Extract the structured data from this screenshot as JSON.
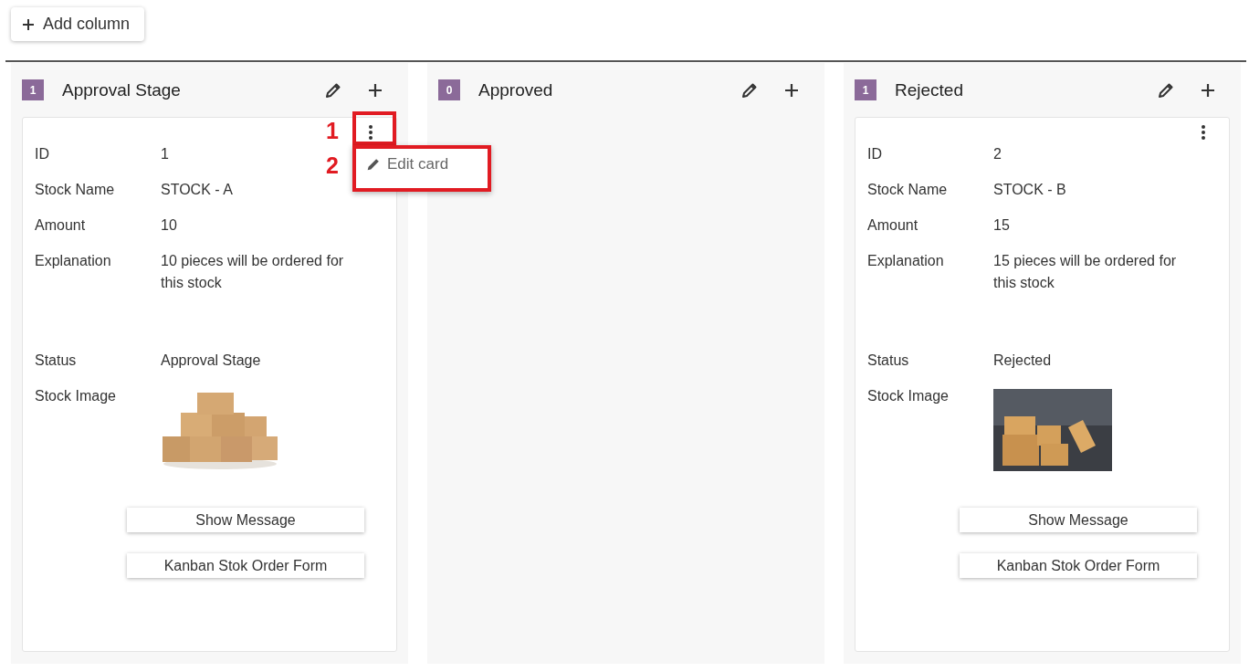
{
  "toolbar": {
    "add_button": "Add column"
  },
  "columns": [
    {
      "count": "1",
      "title": "Approval Stage",
      "cards": [
        {
          "fields": [
            {
              "kind": "text",
              "label": "ID",
              "value": "1"
            },
            {
              "kind": "text",
              "label": "Stock Name",
              "value": "STOCK - A"
            },
            {
              "kind": "text",
              "label": "Amount",
              "value": "10"
            },
            {
              "kind": "long",
              "label": "Explanation",
              "value": "10 pieces will be ordered for this stock"
            },
            {
              "kind": "text",
              "label": "Status",
              "value": "Approval Stage"
            },
            {
              "label": "Stock Image"
            }
          ],
          "buttons": [
            "Show Message",
            "Kanban Stok Order Form"
          ],
          "menu_callout": "1",
          "menu": {
            "callout": "2",
            "items": [
              "Edit card"
            ]
          }
        }
      ]
    },
    {
      "count": "0",
      "title": "Approved"
    },
    {
      "count": "1",
      "title": "Rejected",
      "cards": [
        {
          "fields": [
            {
              "kind": "text",
              "label": "ID",
              "value": "2"
            },
            {
              "kind": "text",
              "label": "Stock Name",
              "value": "STOCK - B"
            },
            {
              "kind": "text",
              "label": "Amount",
              "value": "15"
            },
            {
              "kind": "long",
              "label": "Explanation",
              "value": "15 pieces will be ordered for this stock"
            },
            {
              "kind": "text",
              "label": "Status",
              "value": "Rejected"
            },
            {
              "label": "Stock Image"
            }
          ],
          "buttons": [
            "Show Message",
            "Kanban Stok Order Form"
          ]
        }
      ]
    }
  ]
}
